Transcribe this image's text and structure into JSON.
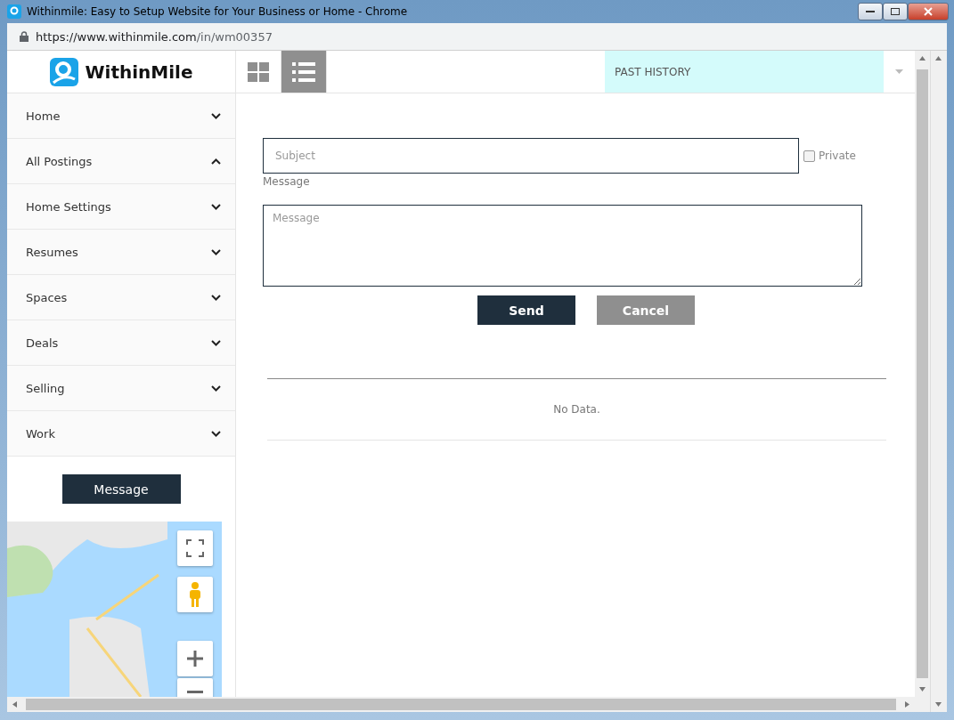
{
  "window": {
    "title": "Withinmile: Easy to Setup Website for Your Business or Home - Chrome"
  },
  "address_bar": {
    "url_host": "https://www.withinmile.com",
    "url_path": "/in/wm00357"
  },
  "logo": {
    "text": "WithinMile"
  },
  "view_toggle": [
    {
      "kind": "grid",
      "selected": false
    },
    {
      "kind": "list",
      "selected": true
    }
  ],
  "history_select": {
    "value": "PAST HISTORY"
  },
  "sidebar": {
    "items": [
      {
        "label": "Home",
        "expanded": false
      },
      {
        "label": "All Postings",
        "expanded": true
      },
      {
        "label": "Home Settings",
        "expanded": false
      },
      {
        "label": "Resumes",
        "expanded": false
      },
      {
        "label": "Spaces",
        "expanded": false
      },
      {
        "label": "Deals",
        "expanded": false
      },
      {
        "label": "Selling",
        "expanded": false
      },
      {
        "label": "Work",
        "expanded": false
      }
    ],
    "message_button": "Message"
  },
  "form": {
    "subject_placeholder": "Subject",
    "private": {
      "label": "Private",
      "checked": false
    },
    "message_label": "Message",
    "message_placeholder": "Message",
    "buttons": [
      {
        "kind": "primary",
        "label": "Send"
      },
      {
        "kind": "secondary",
        "label": "Cancel"
      }
    ]
  },
  "history": {
    "empty_text": "No Data."
  }
}
